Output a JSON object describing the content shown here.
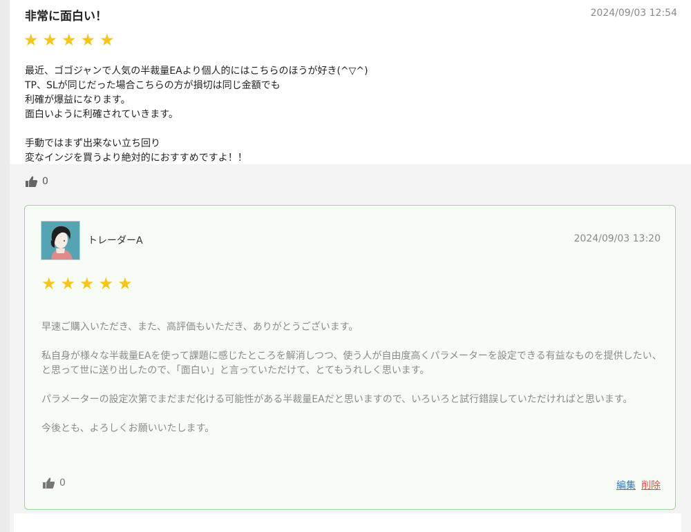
{
  "review": {
    "title": "非常に面白い！",
    "date": "2024/09/03 12:54",
    "rating": 5,
    "body_lines": [
      "最近、ゴゴジャンで人気の半裁量EAより個人的にはこちらのほうが好き(^▽^)",
      "TP、SLが同じだった場合こちらの方が損切は同じ金額でも",
      "利確が爆益になります。",
      "面白いように利確されていきます。",
      "",
      "手動ではまず出来ない立ち回り",
      "変なインジを買うより絶対的におすすめですよ！！"
    ],
    "like_count": "0"
  },
  "reply": {
    "author": "トレーダーA",
    "date": "2024/09/03 13:20",
    "rating": 5,
    "paragraphs": [
      "早速ご購入いただき、また、高評価もいただき、ありがとうございます。",
      "私自身が様々な半裁量EAを使って課題に感じたところを解消しつつ、使う人が自由度高くパラメーターを設定できる有益なものを提供したい、と思って世に送り出したので、「面白い」と言っていただけて、とてもうれしく思います。",
      "パラメーターの設定次第でまだまだ化ける可能性がある半裁量EAだと思いますので、いろいろと試行錯誤していただければと思います。",
      "今後とも、よろしくお願いいたします。"
    ],
    "like_count": "0",
    "edit_label": "編集",
    "delete_label": "削除"
  },
  "colors": {
    "star": "#f5c518",
    "reply_border": "#9fd39a",
    "reply_background": "#f7fcf6",
    "edit_link": "#3a78b8",
    "delete_link": "#d9534f"
  },
  "icons": {
    "like": "thumbs-up-icon",
    "star": "star-icon",
    "avatar": "avatar-illustration"
  }
}
